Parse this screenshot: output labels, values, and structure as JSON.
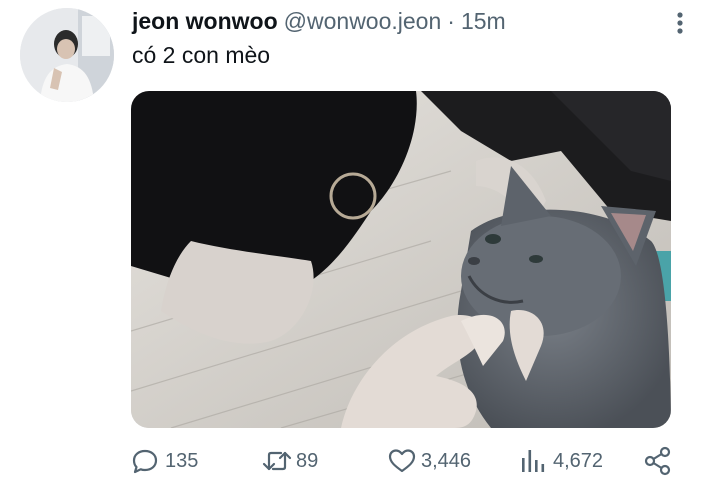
{
  "tweet": {
    "display_name": "jeon wonwoo",
    "handle": "@wonwoo.jeon",
    "separator": "·",
    "time": "15m",
    "text": "có 2 con mèo"
  },
  "icons": {
    "more": "vertical-dots-icon",
    "reply": "speech-bubble-icon",
    "retweet": "retweet-arrows-icon",
    "like": "heart-icon",
    "views": "bar-chart-icon",
    "share": "share-nodes-icon"
  },
  "actions": {
    "replies": "135",
    "retweets": "89",
    "likes": "3,446",
    "views": "4,672"
  },
  "colors": {
    "text_primary": "#0f1419",
    "text_secondary": "#536471",
    "background": "#ffffff"
  }
}
